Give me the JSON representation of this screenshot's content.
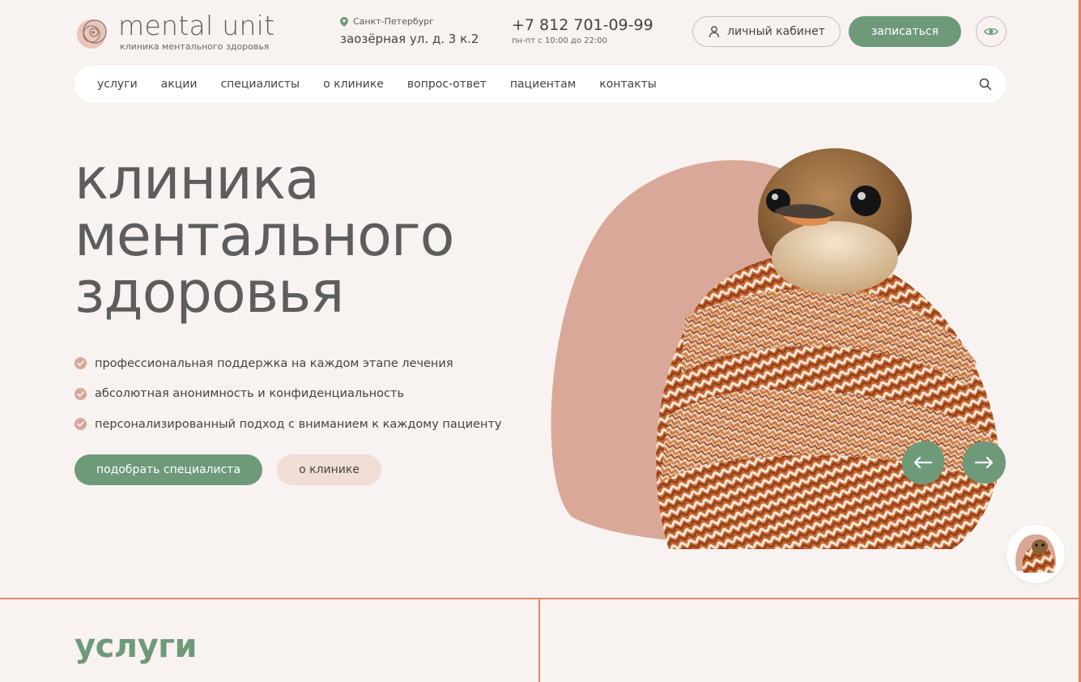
{
  "brand": {
    "name": "mental unit",
    "tagline": "клиника ментального здоровья",
    "accent_green": "#6e9a7a",
    "accent_pink": "#d9a898",
    "accent_orange": "#e08466"
  },
  "address": {
    "city": "Санкт-Петербург",
    "street": "заозёрная ул. д. 3 к.2"
  },
  "contact": {
    "phone": "+7 812 701-09-99",
    "hours": "пн-пт с 10:00 до 22:00"
  },
  "header": {
    "cabinet_label": "личный кабинет",
    "signup_label": "записаться",
    "accessibility_icon": "eye-icon"
  },
  "nav": {
    "items": [
      {
        "label": "услуги"
      },
      {
        "label": "акции"
      },
      {
        "label": "специалисты"
      },
      {
        "label": "о клинике"
      },
      {
        "label": "вопрос-ответ"
      },
      {
        "label": "пациентам"
      },
      {
        "label": "контакты"
      }
    ],
    "search_icon": "search-icon"
  },
  "hero": {
    "title_lines": [
      "клиника",
      "ментального",
      "здоровья"
    ],
    "features": [
      "профессиональная поддержка на каждом этапе лечения",
      "абсолютная анонимность и конфиденциальность",
      "персонализированный подход с вниманием к каждому пациенту"
    ],
    "primary_cta": "подобрать специалиста",
    "secondary_cta": "о клинике",
    "image": "bird-in-knitted-scarf"
  },
  "services": {
    "title": "услуги"
  }
}
